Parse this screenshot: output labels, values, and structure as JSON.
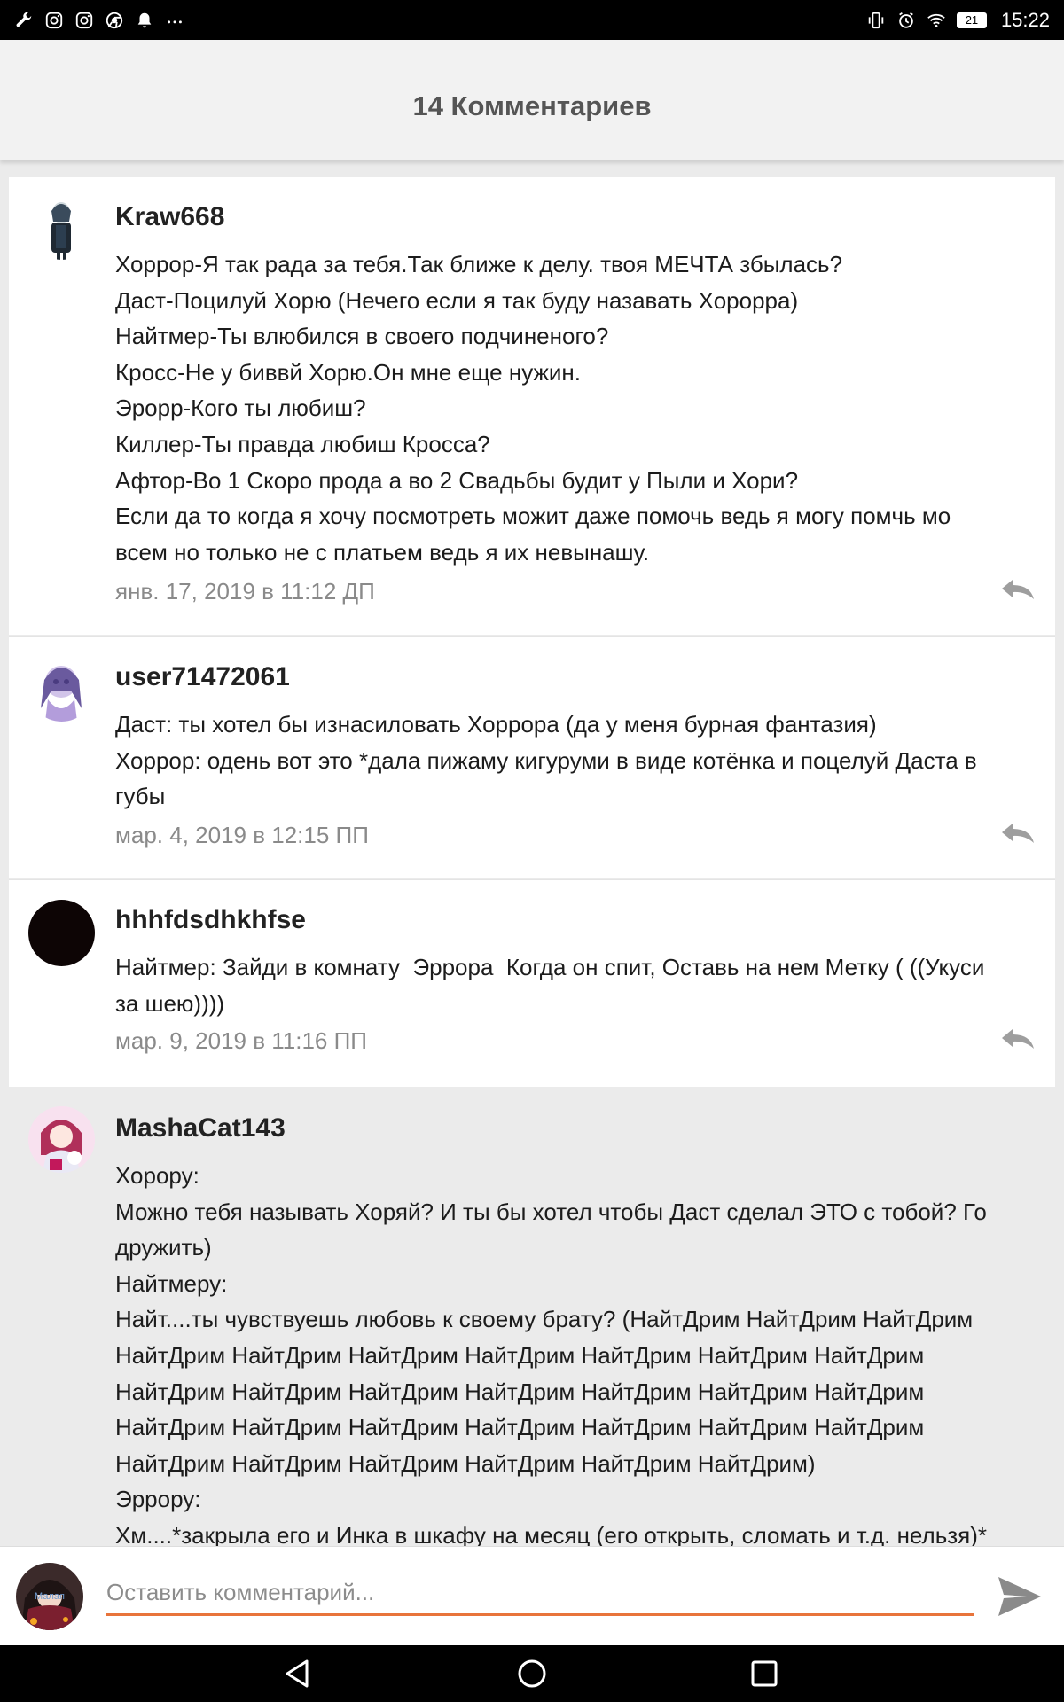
{
  "status_bar": {
    "time": "15:22",
    "battery": "21",
    "icons_left": [
      "wrench-icon",
      "instagram-icon",
      "instagram-icon",
      "chrome-icon",
      "notification-bell-icon",
      "more-icon"
    ],
    "icons_right": [
      "vibrate-icon",
      "alarm-icon",
      "wifi-icon",
      "battery-icon"
    ]
  },
  "header": {
    "title": "14 Комментариев"
  },
  "comments": [
    {
      "author": "Kraw668",
      "lines": [
        "Хоррор-Я так рада за тебя.Так ближе к делу. твоя МЕЧТА збылась?",
        "Даст-Поцилуй Хорю (Нечего если я так буду назавать Хорорра)",
        "Найтмер-Ты влюбился в своего подчиненого?",
        "Кросс-Не у биввй Хорю.Он мне еще нужин.",
        "Эрорр-Кого ты любиш?",
        "Киллер-Ты правда любиш Кросса?",
        "Афтор-Во 1 Скоро прода а во 2 Свадьбы будит у Пыли и Хори?",
        "Если да то когда я хочу посмотреть можит даже помочь ведь я могу помчь мо",
        "всем но только не с платьем ведь я их невынашу."
      ],
      "timestamp": "янв. 17, 2019 в 11:12 ДП"
    },
    {
      "author": "user71472061",
      "lines": [
        "Даст: ты хотел бы изнасиловать Хоррора (да у меня бурная фантазия)",
        "Хоррор: одень вот это *дала пижаму кигуруми в виде котёнка и поцелуй Даста в",
        "губы"
      ],
      "timestamp": "мар. 4, 2019 в 12:15 ПП"
    },
    {
      "author": "hhhfdsdhkhfse",
      "lines": [
        "Найтмер: Зайди в комнату  Эррора  Когда он спит, Оставь на нем Метку ( ((Укуси",
        "за шею))))"
      ],
      "timestamp": "мар. 9, 2019 в 11:16 ПП"
    },
    {
      "author": "MashaCat143",
      "lines": [
        "Хорору:",
        "Можно тебя называть Хоряй? И ты бы хотел чтобы Даст сделал ЭТО с тобой? Го",
        "дружить)",
        "Найтмеру:",
        "Найт....ты чувствуешь любовь к своему брату? (НайтДрим НайтДрим НайтДрим",
        "НайтДрим НайтДрим НайтДрим НайтДрим НайтДрим НайтДрим НайтДрим",
        "НайтДрим НайтДрим НайтДрим НайтДрим НайтДрим НайтДрим НайтДрим",
        "НайтДрим НайтДрим НайтДрим НайтДрим НайтДрим НайтДрим НайтДрим",
        "НайтДрим НайтДрим НайтДрим НайтДрим НайтДрим НайтДрим)",
        "Эррору:",
        "Хм....*закрыла его и Инка в шкафу на месяц (его открыть, сломать и т.д. нельзя)*"
      ],
      "timestamp": ""
    }
  ],
  "composer": {
    "placeholder": "Оставить комментарий...",
    "avatar_caption": "Малая",
    "send_icon": "send-icon"
  },
  "nav_bar": {
    "icons": [
      "back-icon",
      "home-icon",
      "recents-icon"
    ]
  },
  "colors": {
    "accent": "#e8743b",
    "status_bar": "#000000",
    "header_bg": "#f2f2f2",
    "page_bg": "#ebebeb"
  }
}
